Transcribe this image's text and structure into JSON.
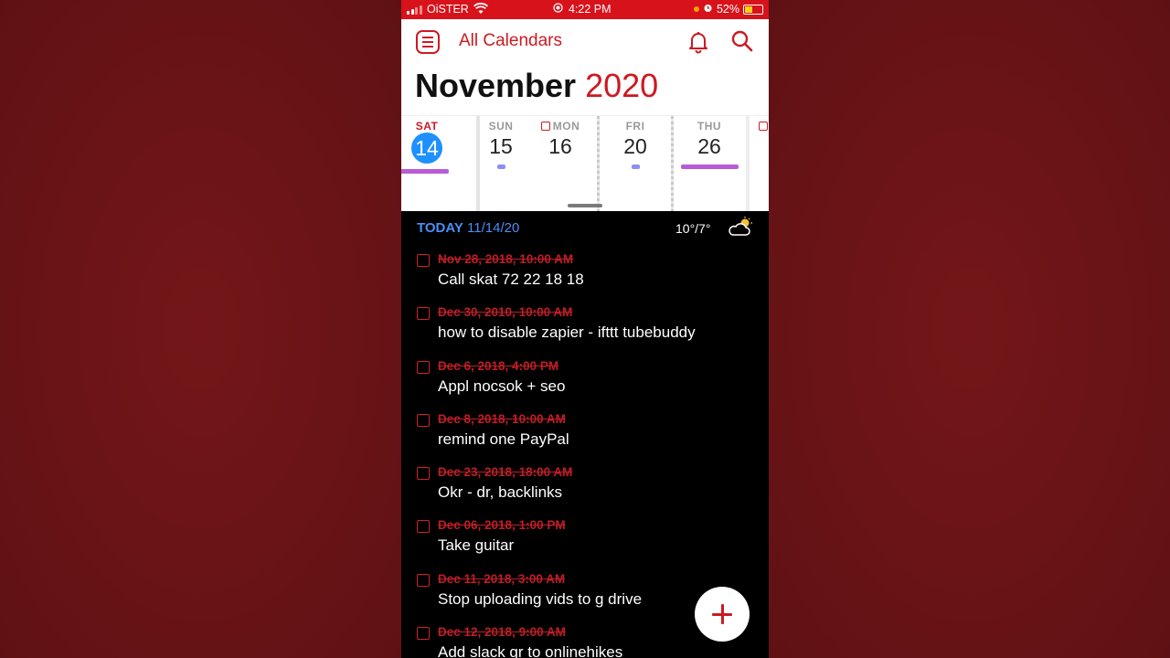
{
  "status_bar": {
    "carrier": "OiSTER",
    "time": "4:22 PM",
    "battery": "52%",
    "battery_level": 0.52
  },
  "header": {
    "calendar_selector": "All Calendars",
    "month": "November",
    "year": "2020"
  },
  "week_strip": {
    "days": [
      {
        "name": "SAT",
        "num": "14",
        "today": true,
        "bar_color": "#b85cd6"
      },
      {
        "name": "SUN",
        "num": "15",
        "bar_color": "#8f8ef0"
      },
      {
        "name": "MON",
        "num": "16",
        "has_task": true
      },
      {
        "name": "FRI",
        "num": "20",
        "bar_color": "#8f8ef0"
      },
      {
        "name": "THU",
        "num": "26",
        "bar_color": "#b85cd6"
      }
    ]
  },
  "today_row": {
    "label": "TODAY",
    "date": "11/14/20",
    "temperature": "10°/7°",
    "weather_icon": "partly-cloudy-icon"
  },
  "tasks": [
    {
      "date": "Nov 28, 2018, 10:00 AM",
      "title": "Call skat 72 22 18 18"
    },
    {
      "date": "Dec 30, 2010, 10:00 AM",
      "title": "how to disable zapier - ifttt tubebuddy"
    },
    {
      "date": "Dec 6, 2018, 4:00 PM",
      "title": "Appl nocsok + seo"
    },
    {
      "date": "Dec 8, 2018, 10:00 AM",
      "title": "remind one PayPal"
    },
    {
      "date": "Dec 23, 2018, 18:00 AM",
      "title": "Okr - dr, backlinks"
    },
    {
      "date": "Dec 06, 2018, 1:00 PM",
      "title": "Take guitar"
    },
    {
      "date": "Dec 11, 2018, 3:00 AM",
      "title": "Stop uploading vids to g drive"
    },
    {
      "date": "Dec 12, 2018, 9:00 AM",
      "title": "Add slack gr to onlinehikes"
    }
  ],
  "colors": {
    "accent": "#cc1a22",
    "status_bar": "#d8121b",
    "today_blue": "#1e90ff",
    "background": "#6e1518"
  }
}
